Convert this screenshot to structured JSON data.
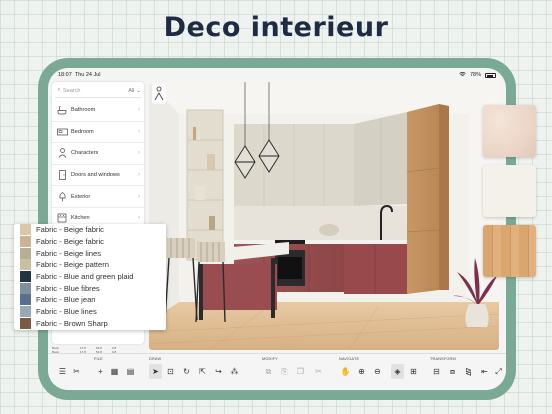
{
  "headline": "Deco interieur",
  "status": {
    "time": "18:07",
    "date": "Thu 24 Jul",
    "battery": "78%"
  },
  "sidebar": {
    "search_placeholder": "Search",
    "filter": "All",
    "categories": [
      {
        "label": "Bathroom",
        "icon": "bathtub-icon"
      },
      {
        "label": "Bedroom",
        "icon": "bed-icon"
      },
      {
        "label": "Characters",
        "icon": "person-icon"
      },
      {
        "label": "Doors and windows",
        "icon": "door-icon"
      },
      {
        "label": "Exterior",
        "icon": "tree-icon"
      },
      {
        "label": "Kitchen",
        "icon": "kitchen-icon"
      }
    ]
  },
  "fabrics": [
    {
      "label": "Fabric - Beige fabric",
      "color": "#d9c7a8"
    },
    {
      "label": "Fabric - Beige fabric",
      "color": "#c9b593"
    },
    {
      "label": "Fabric - Beige lines",
      "color": "#b8ad95"
    },
    {
      "label": "Fabric - Beige pattern",
      "color": "#cbbf9f"
    },
    {
      "label": "Fabric - Blue and green plaid",
      "color": "#1f3640"
    },
    {
      "label": "Fabric - Blue fibres",
      "color": "#7f90a3"
    },
    {
      "label": "Fabric - Blue jean",
      "color": "#5a6f8c"
    },
    {
      "label": "Fabric - Blue lines",
      "color": "#9aa8b6"
    },
    {
      "label": "Fabric - Brown Sharp",
      "color": "#7b5a43"
    }
  ],
  "materials": [
    {
      "name": "pink-marble",
      "color": "#ecd6c8"
    },
    {
      "name": "white-matte",
      "color": "#f3f1ea"
    },
    {
      "name": "light-oak",
      "color": "#d9a670"
    }
  ],
  "toolbar": {
    "groups": {
      "file": "FILE",
      "draw": "DRAW",
      "modify": "MODIFY",
      "navigate": "NAVIGATE",
      "transform": "TRANSFORM"
    },
    "buttons": [
      {
        "name": "menu-icon",
        "glyph": "☰"
      },
      {
        "name": "tools-icon",
        "glyph": "✂"
      },
      {
        "name": "add-icon",
        "glyph": "+"
      },
      {
        "name": "import-plan-icon",
        "glyph": "▦"
      },
      {
        "name": "export-icon",
        "glyph": "▤"
      },
      {
        "name": "select-arrow-icon",
        "glyph": "➤"
      },
      {
        "name": "draw-room-icon",
        "glyph": "⊡"
      },
      {
        "name": "rotate-icon",
        "glyph": "↻"
      },
      {
        "name": "measure-icon",
        "glyph": "⇱"
      },
      {
        "name": "redo-icon",
        "glyph": "↪"
      },
      {
        "name": "text-icon",
        "glyph": "⁂"
      },
      {
        "name": "copy-icon",
        "glyph": "⧉"
      },
      {
        "name": "paste-icon",
        "glyph": "⎘"
      },
      {
        "name": "duplicate-icon",
        "glyph": "❐"
      },
      {
        "name": "cut-icon",
        "glyph": "✂"
      },
      {
        "name": "pan-hand-icon",
        "glyph": "✋"
      },
      {
        "name": "zoom-in-icon",
        "glyph": "⊕"
      },
      {
        "name": "zoom-out-icon",
        "glyph": "⊖"
      },
      {
        "name": "layers-icon",
        "glyph": "◈"
      },
      {
        "name": "fit-view-icon",
        "glyph": "⊞"
      },
      {
        "name": "flip-icon",
        "glyph": "⊟"
      },
      {
        "name": "align-icon",
        "glyph": "⧈"
      },
      {
        "name": "mirror-icon",
        "glyph": "⧎"
      },
      {
        "name": "undo-icon",
        "glyph": "⇤"
      },
      {
        "name": "expand-icon",
        "glyph": "⤢"
      }
    ]
  },
  "mini_table": [
    {
      "name": "Book",
      "a": "17.8",
      "b": "53.8",
      "c": "0.8"
    },
    {
      "name": "Book",
      "a": "17.8",
      "b": "53.8",
      "c": "0.8"
    }
  ]
}
